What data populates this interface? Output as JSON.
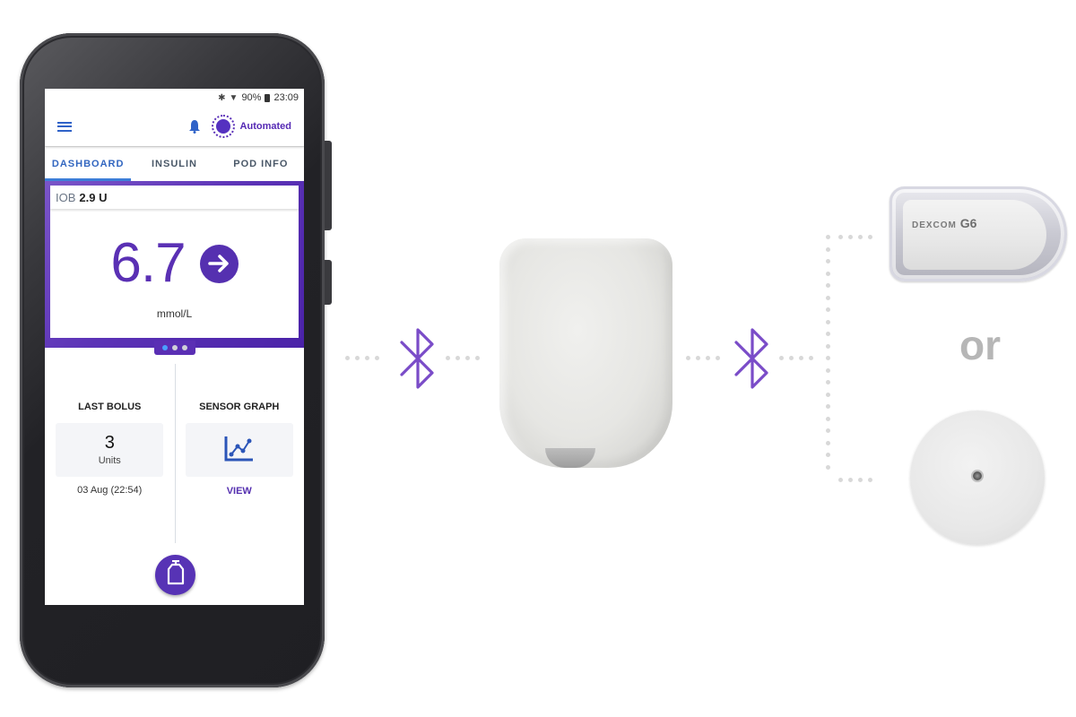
{
  "status_bar": {
    "battery_percent": "90%",
    "time": "23:09",
    "icons": [
      "bluetooth-icon",
      "wifi-icon",
      "battery-icon"
    ]
  },
  "app_header": {
    "menu_icon": "menu-icon",
    "notification_icon": "bell-icon",
    "mode_label": "Automated"
  },
  "tabs": [
    {
      "label": "DASHBOARD",
      "active": true
    },
    {
      "label": "INSULIN",
      "active": false
    },
    {
      "label": "POD INFO",
      "active": false
    }
  ],
  "glucose_card": {
    "iob_label": "IOB",
    "iob_value": "2.9 U",
    "glucose_value": "6.7",
    "trend": "steady-arrow-right",
    "unit": "mmol/L",
    "pager": {
      "pages": 3,
      "active_index": 0
    }
  },
  "last_bolus": {
    "title": "LAST BOLUS",
    "value": "3",
    "unit": "Units",
    "time": "03 Aug (22:54)"
  },
  "sensor_graph": {
    "title": "SENSOR GRAPH",
    "icon": "line-chart-icon",
    "link_label": "VIEW"
  },
  "fab": {
    "icon": "insulin-vial-icon"
  },
  "devices": {
    "pod": "pod-device",
    "cgm_option_1_label": "DEXCOM",
    "cgm_option_1_model": "G6",
    "separator": "or",
    "cgm_option_2": "libre-sensor"
  },
  "colors": {
    "brand_purple": "#5530b0",
    "tab_active_blue": "#3266c0",
    "connector_dots": "#d8d8d8",
    "or_text": "#b6b6b6"
  }
}
